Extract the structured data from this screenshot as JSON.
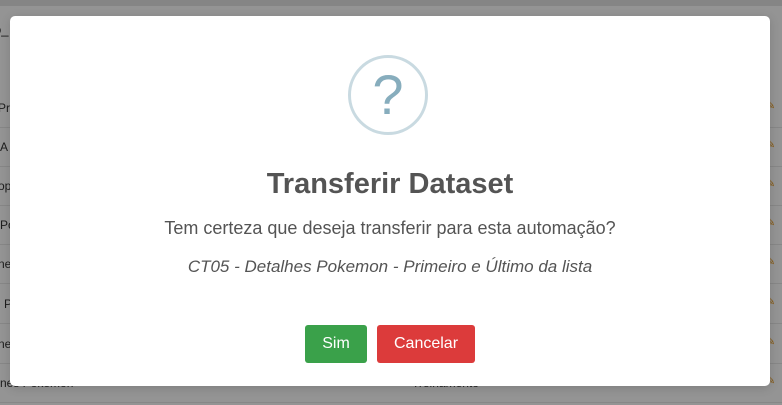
{
  "background": {
    "title": "o_",
    "rows": [
      {
        "label": "Pr"
      },
      {
        "label": "A"
      },
      {
        "label": "op"
      },
      {
        "label": "Po"
      },
      {
        "label": "ne"
      },
      {
        "label": "P"
      },
      {
        "label": "ne"
      },
      {
        "label": "nes Pokemon"
      }
    ],
    "last_row_right": "Treinamento"
  },
  "modal": {
    "title": "Transferir Dataset",
    "text": "Tem certeza que deseja transferir para esta automação?",
    "item": "CT05 - Detalhes Pokemon - Primeiro e Último da lista",
    "icon_glyph": "?",
    "confirm_label": "Sim",
    "cancel_label": "Cancelar"
  },
  "colors": {
    "confirm": "#3aa14a",
    "cancel": "#dc3b3b",
    "icon": "#87adbd",
    "icon_ring": "#c9dae1",
    "edit_icon": "#e89a20"
  }
}
